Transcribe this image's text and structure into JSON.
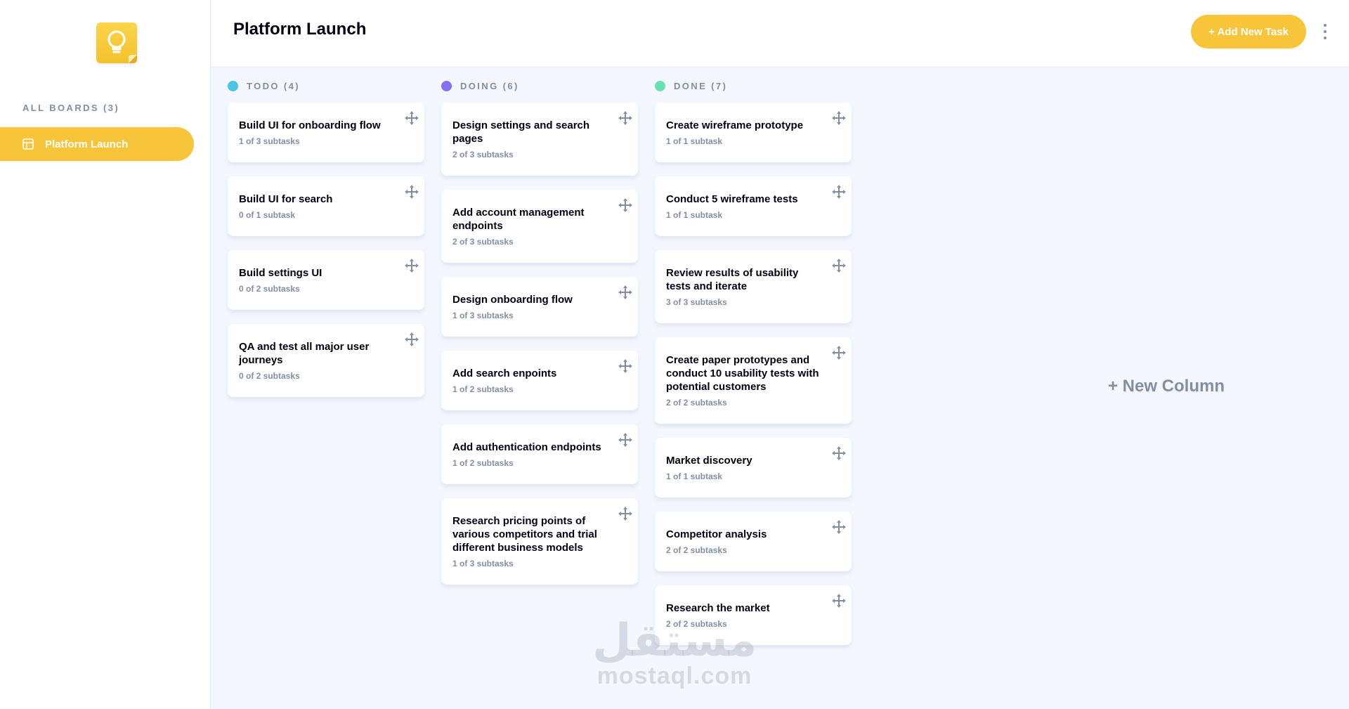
{
  "app": {
    "logo_icon": "lightbulb-icon",
    "accent_color": "#F8C43A"
  },
  "sidebar": {
    "boards_heading": "ALL BOARDS (3)",
    "items": [
      {
        "label": "Platform Launch",
        "icon": "board-icon",
        "active": true
      }
    ]
  },
  "header": {
    "title": "Platform Launch",
    "add_task_label": "+ Add New Task",
    "menu_icon": "vertical-ellipsis-icon"
  },
  "columns": [
    {
      "title": "TODO (4)",
      "dot_color": "#49C4E5",
      "tasks": [
        {
          "title": "Build UI for onboarding flow",
          "subtasks": "1 of 3 subtasks"
        },
        {
          "title": "Build UI for search",
          "subtasks": "0 of 1 subtask"
        },
        {
          "title": "Build settings UI",
          "subtasks": "0 of 2 subtasks"
        },
        {
          "title": "QA and test all major user journeys",
          "subtasks": "0 of 2 subtasks"
        }
      ]
    },
    {
      "title": "DOING (6)",
      "dot_color": "#8471F2",
      "tasks": [
        {
          "title": "Design settings and search pages",
          "subtasks": "2 of 3 subtasks"
        },
        {
          "title": "Add account management endpoints",
          "subtasks": "2 of 3 subtasks"
        },
        {
          "title": "Design onboarding flow",
          "subtasks": "1 of 3 subtasks"
        },
        {
          "title": "Add search enpoints",
          "subtasks": "1 of 2 subtasks"
        },
        {
          "title": "Add authentication endpoints",
          "subtasks": "1 of 2 subtasks"
        },
        {
          "title": "Research pricing points of various competitors and trial different business models",
          "subtasks": "1 of 3 subtasks"
        }
      ]
    },
    {
      "title": "DONE (7)",
      "dot_color": "#67E2AE",
      "tasks": [
        {
          "title": "Create wireframe prototype",
          "subtasks": "1 of 1 subtask"
        },
        {
          "title": "Conduct 5 wireframe tests",
          "subtasks": "1 of 1 subtask"
        },
        {
          "title": "Review results of usability tests and iterate",
          "subtasks": "3 of 3 subtasks"
        },
        {
          "title": "Create paper prototypes and conduct 10 usability tests with potential customers",
          "subtasks": "2 of 2 subtasks"
        },
        {
          "title": "Market discovery",
          "subtasks": "1 of 1 subtask"
        },
        {
          "title": "Competitor analysis",
          "subtasks": "2 of 2 subtasks"
        },
        {
          "title": "Research the market",
          "subtasks": "2 of 2 subtasks"
        }
      ]
    }
  ],
  "new_column_label": "+ New Column",
  "card_icon": "drag-move-icon",
  "watermark": {
    "arabic": "مستقل",
    "latin": "mostaql.com"
  }
}
